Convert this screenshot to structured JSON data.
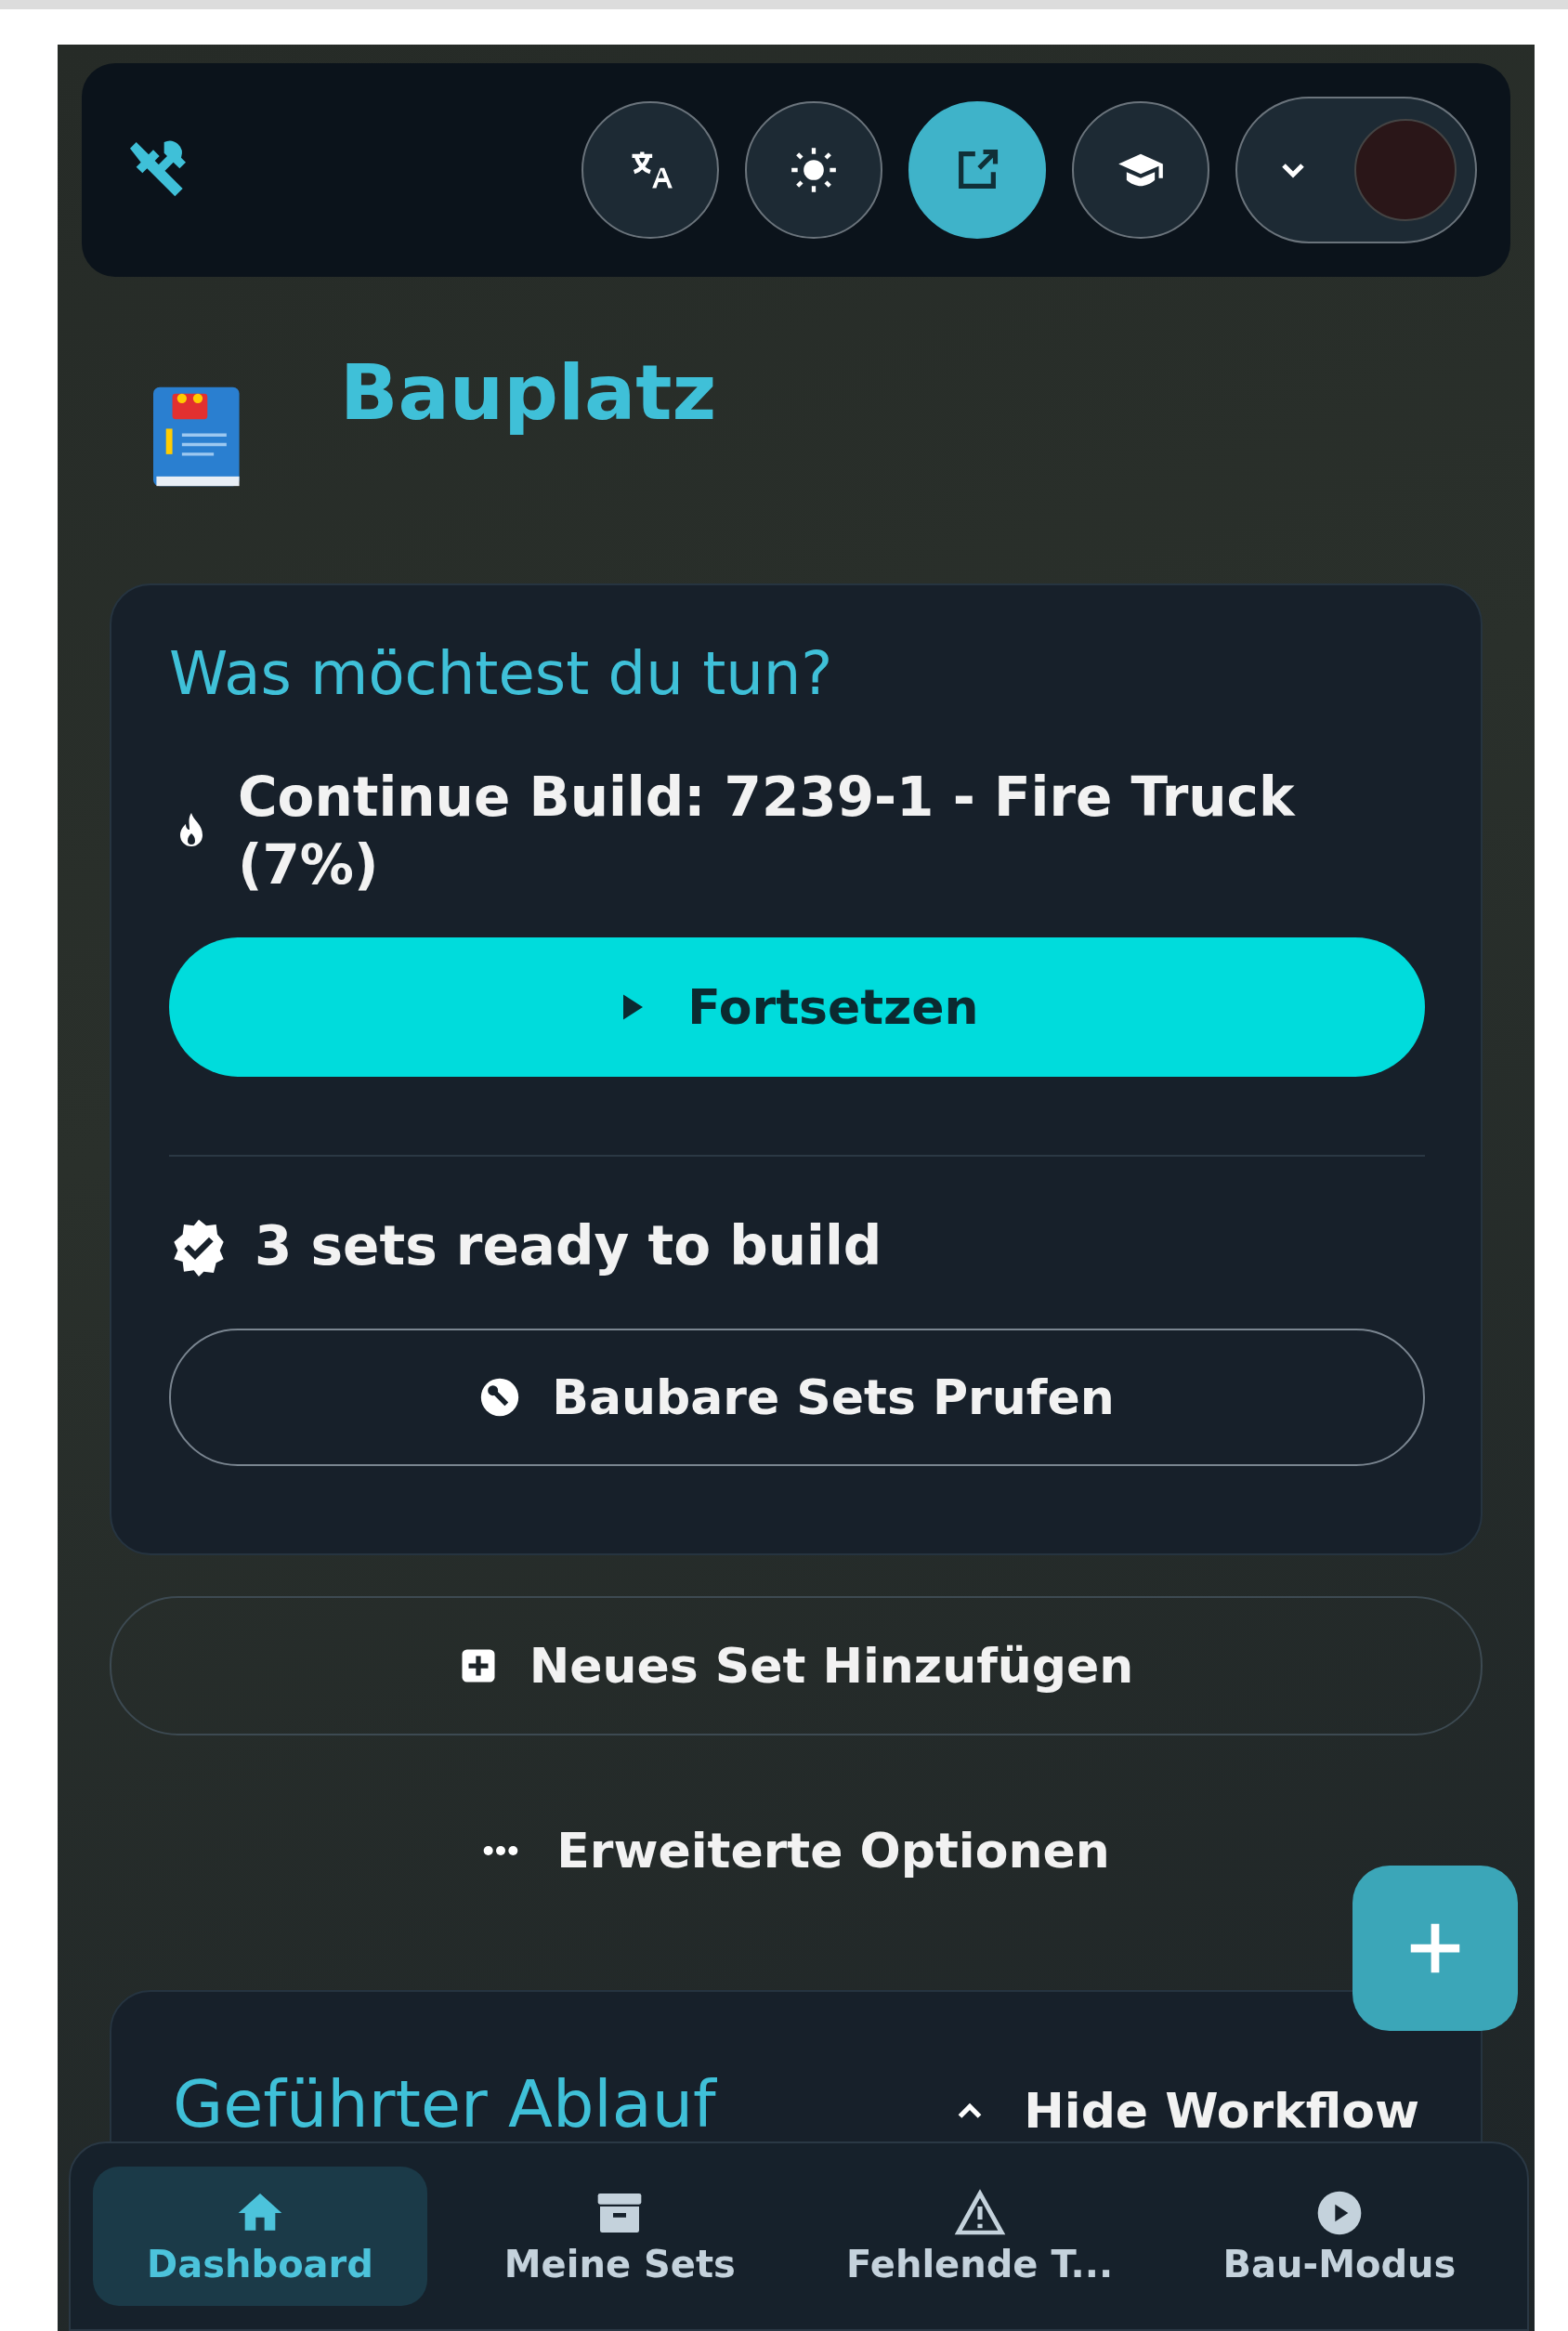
{
  "app_bar": {
    "icon_buttons": [
      {
        "selected": false
      },
      {
        "selected": false
      },
      {
        "selected": true
      },
      {
        "selected": false
      }
    ]
  },
  "page_title": "Bauplatz",
  "action_card": {
    "heading": "Was möchtest du tun?",
    "continue_text": "Continue Build: 7239-1 - Fire Truck (7%)",
    "continue_button": "Fortsetzen",
    "ready_text": "3 sets ready to build",
    "check_button": "Baubare Sets Prufen"
  },
  "add_set_button": "Neues Set Hinzufügen",
  "more_options": "Erweiterte Optionen",
  "workflow_card": {
    "heading": "Geführter Ablauf",
    "toggle": "Hide Workflow"
  },
  "bottom_nav": [
    {
      "label": "Dashboard",
      "selected": true
    },
    {
      "label": "Meine Sets",
      "selected": false
    },
    {
      "label": "Fehlende T...",
      "selected": false
    },
    {
      "label": "Bau-Modus",
      "selected": false
    }
  ]
}
